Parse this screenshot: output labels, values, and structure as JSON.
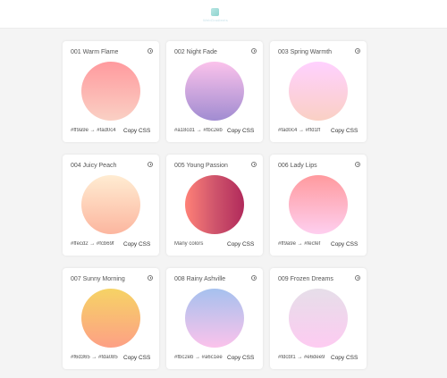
{
  "header": {
    "brand": "WebGradients"
  },
  "cards": [
    {
      "name": "001 Warm Flame",
      "codes": "#ff9a9e → #fad0c4",
      "copy_label": "Copy CSS",
      "colors": [
        "#ff9a9e",
        "#fad0c4"
      ]
    },
    {
      "name": "002 Night Fade",
      "codes": "#a18cd1 → #fbc2eb",
      "copy_label": "Copy CSS",
      "colors": [
        "#fbc2eb",
        "#a18cd1"
      ]
    },
    {
      "name": "003 Spring Warmth",
      "codes": "#fad0c4 → #ffd1ff",
      "copy_label": "Copy CSS",
      "colors": [
        "#ffd1ff",
        "#fad0c4"
      ]
    },
    {
      "name": "004 Juicy Peach",
      "codes": "#ffecd2 → #fcb69f",
      "copy_label": "Copy CSS",
      "colors": [
        "#ffecd2",
        "#fcb69f"
      ]
    },
    {
      "name": "005 Young Passion",
      "codes": "Many colors",
      "copy_label": "Copy CSS",
      "colors": [
        "#ff8177",
        "#cf556c",
        "#b12a5b"
      ]
    },
    {
      "name": "006 Lady Lips",
      "codes": "#ff9a9e → #fecfef",
      "copy_label": "Copy CSS",
      "colors": [
        "#ff9a9e",
        "#fecfef"
      ]
    },
    {
      "name": "007 Sunny Morning",
      "codes": "#f6d365 → #fda085",
      "copy_label": "Copy CSS",
      "colors": [
        "#f6d365",
        "#fda085"
      ]
    },
    {
      "name": "008 Rainy Ashville",
      "codes": "#fbc2eb → #a6c1ee",
      "copy_label": "Copy CSS",
      "colors": [
        "#a6c1ee",
        "#fbc2eb"
      ]
    },
    {
      "name": "009 Frozen Dreams",
      "codes": "#fdcbf1 → #e6dee9",
      "copy_label": "Copy CSS",
      "colors": [
        "#e6dee9",
        "#fdcbf1"
      ]
    }
  ]
}
